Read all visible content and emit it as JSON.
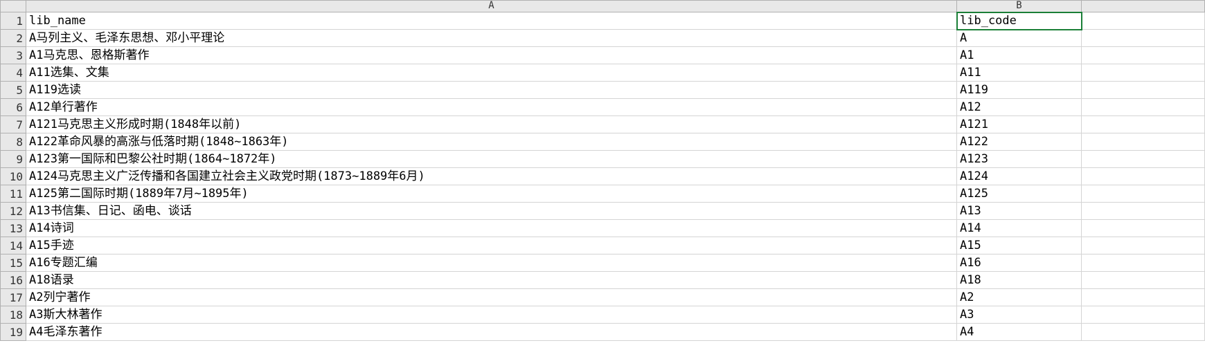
{
  "columns": [
    "A",
    "B",
    ""
  ],
  "rows": [
    {
      "n": "1",
      "a": "lib_name",
      "b": "lib_code",
      "c": ""
    },
    {
      "n": "2",
      "a": "A马列主义、毛泽东思想、邓小平理论",
      "b": "A",
      "c": ""
    },
    {
      "n": "3",
      "a": "A1马克思、恩格斯著作",
      "b": "A1",
      "c": ""
    },
    {
      "n": "4",
      "a": "A11选集、文集",
      "b": "A11",
      "c": ""
    },
    {
      "n": "5",
      "a": "A119选读",
      "b": "A119",
      "c": ""
    },
    {
      "n": "6",
      "a": "A12单行著作",
      "b": "A12",
      "c": ""
    },
    {
      "n": "7",
      "a": "A121马克思主义形成时期(1848年以前)",
      "b": "A121",
      "c": ""
    },
    {
      "n": "8",
      "a": "A122革命风暴的高涨与低落时期(1848~1863年)",
      "b": "A122",
      "c": ""
    },
    {
      "n": "9",
      "a": "A123第一国际和巴黎公社时期(1864~1872年)",
      "b": "A123",
      "c": ""
    },
    {
      "n": "10",
      "a": "A124马克思主义广泛传播和各国建立社会主义政党时期(1873~1889年6月)",
      "b": "A124",
      "c": ""
    },
    {
      "n": "11",
      "a": "A125第二国际时期(1889年7月~1895年)",
      "b": "A125",
      "c": ""
    },
    {
      "n": "12",
      "a": "A13书信集、日记、函电、谈话",
      "b": "A13",
      "c": ""
    },
    {
      "n": "13",
      "a": "A14诗词",
      "b": "A14",
      "c": ""
    },
    {
      "n": "14",
      "a": "A15手迹",
      "b": "A15",
      "c": ""
    },
    {
      "n": "15",
      "a": "A16专题汇编",
      "b": "A16",
      "c": ""
    },
    {
      "n": "16",
      "a": "A18语录",
      "b": "A18",
      "c": ""
    },
    {
      "n": "17",
      "a": "A2列宁著作",
      "b": "A2",
      "c": ""
    },
    {
      "n": "18",
      "a": "A3斯大林著作",
      "b": "A3",
      "c": ""
    },
    {
      "n": "19",
      "a": "A4毛泽东著作",
      "b": "A4",
      "c": ""
    }
  ],
  "active_cell": "B1"
}
